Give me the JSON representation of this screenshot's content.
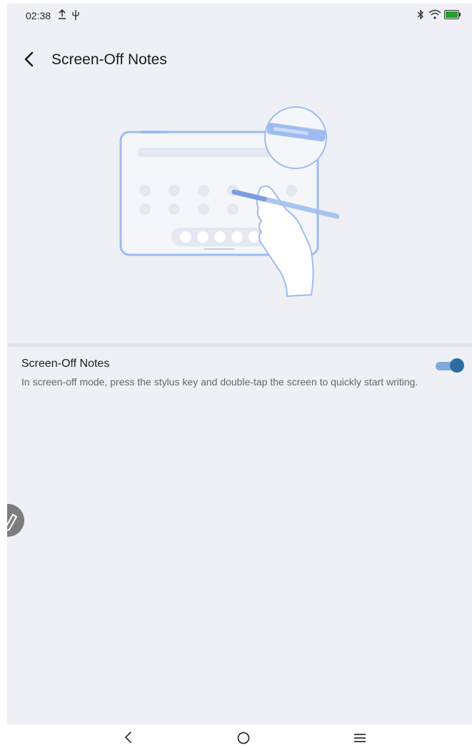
{
  "status_bar": {
    "time": "02:38",
    "icons": [
      "upload-icon",
      "usb-icon",
      "bluetooth-icon",
      "wifi-icon",
      "battery-icon"
    ],
    "battery_color": "#1fa12b"
  },
  "header": {
    "back_icon": "back-arrow-icon",
    "title": "Screen-Off Notes"
  },
  "illustration": {
    "description_icon": "tablet-stylus-illustration-icon",
    "accent_color": "#9ebcf0"
  },
  "setting": {
    "title": "Screen-Off Notes",
    "description": "In screen-off mode, press the stylus key and double-tap the screen to quickly start writing.",
    "toggle_on": true,
    "toggle_color": "#2a6ca3"
  },
  "floating_button": {
    "icon": "pen-icon"
  },
  "nav_bar": {
    "buttons": [
      "back-icon",
      "home-icon",
      "menu-icon"
    ]
  }
}
